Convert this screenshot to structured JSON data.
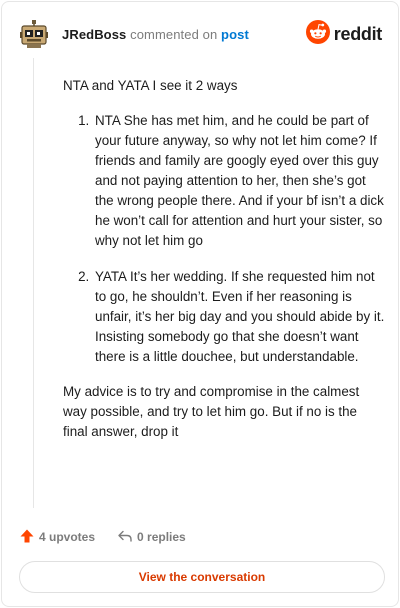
{
  "colors": {
    "brand": "#ff4500",
    "upvote": "#ff4500",
    "link": "#0079d3",
    "cta_text": "#d93a00",
    "muted": "#7c7c7c"
  },
  "header": {
    "username": "JRedBoss",
    "action_text": "commented on",
    "post_link": "post",
    "avatar_icon": "robot-avatar-icon",
    "logo_icon": "reddit-snoo-icon",
    "logo_text": "reddit"
  },
  "comment": {
    "intro": "NTA and YATA I see it 2 ways",
    "points": [
      {
        "number": "1.",
        "text": "NTA She has met him, and he could be part of your future anyway, so why not let him come? If friends and family are googly eyed over this guy and not paying attention to her, then she’s got the wrong people there. And if your bf isn’t a dick he won’t call for attention and hurt your sister, so why not let him go"
      },
      {
        "number": "2.",
        "text": "YATA It’s her wedding. If she requested him not to go, he shouldn’t. Even if her reasoning is unfair, it’s her big day and you should abide by it. Insisting somebody go that she doesn’t want there is a little douchee, but understandable."
      }
    ],
    "advice": "My advice is to try and compromise in the calmest way possible, and try to let him go. But if no is the final answer, drop it"
  },
  "footer": {
    "upvotes": "4 upvotes",
    "replies": "0 replies",
    "upvote_icon": "upvote-arrow-icon",
    "reply_icon": "reply-arrow-icon"
  },
  "cta": {
    "label": "View the conversation"
  }
}
